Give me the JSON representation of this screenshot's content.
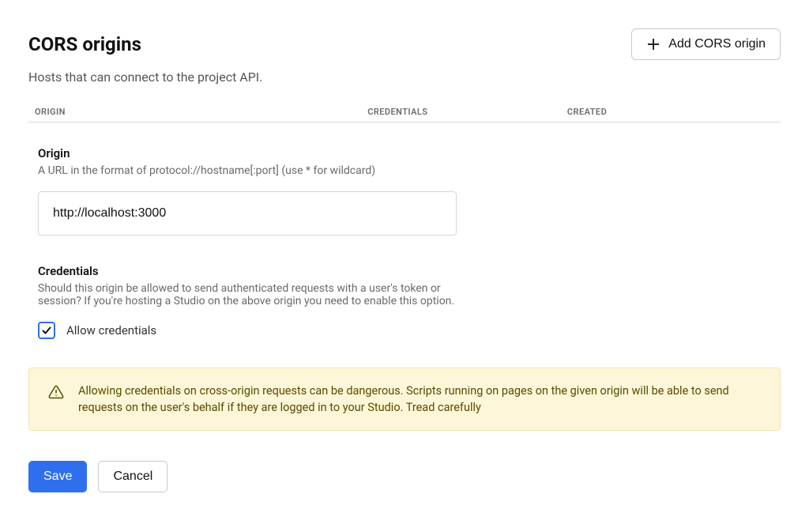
{
  "header": {
    "title": "CORS origins",
    "subtitle": "Hosts that can connect to the project API.",
    "add_button_label": "Add CORS origin"
  },
  "table": {
    "col_origin": "ORIGIN",
    "col_credentials": "CREDENTIALS",
    "col_created": "CREATED"
  },
  "form": {
    "origin": {
      "label": "Origin",
      "help": "A URL in the format of protocol://hostname[:port] (use * for wildcard)",
      "value": "http://localhost:3000"
    },
    "credentials": {
      "label": "Credentials",
      "help": "Should this origin be allowed to send authenticated requests with a user's token or session? If you're hosting a Studio on the above origin you need to enable this option.",
      "checkbox_label": "Allow credentials",
      "checked": true
    },
    "alert": {
      "text": "Allowing credentials on cross-origin requests can be dangerous. Scripts running on pages on the given origin will be able to send requests on the user's behalf if they are logged in to your Studio. Tread carefully"
    },
    "actions": {
      "save_label": "Save",
      "cancel_label": "Cancel"
    }
  }
}
